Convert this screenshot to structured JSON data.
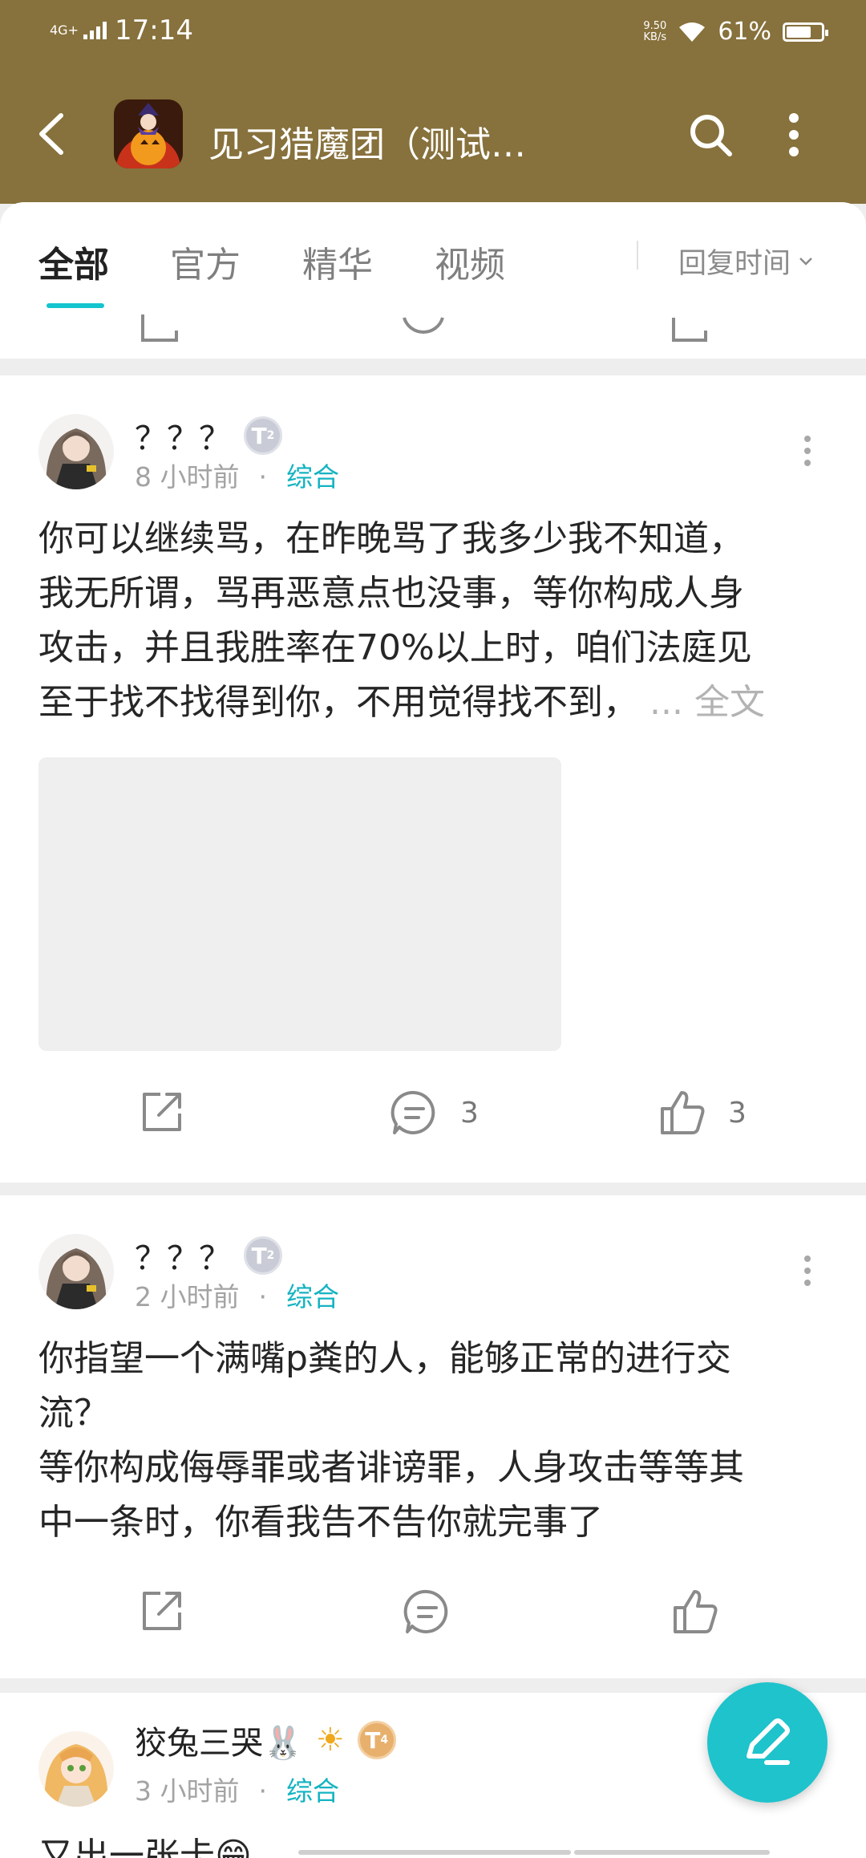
{
  "status_bar": {
    "network": "4G+",
    "time": "17:14",
    "speed_value": "9.50",
    "speed_unit": "KB/s",
    "battery": "61%",
    "battery_level": 0.61
  },
  "app_bar": {
    "title": "见习猎魔团（测试…",
    "game_icon": "game-icon"
  },
  "tabs": [
    {
      "label": "全部",
      "active": true
    },
    {
      "label": "官方",
      "active": false
    },
    {
      "label": "精华",
      "active": false
    },
    {
      "label": "视频",
      "active": false
    }
  ],
  "sort": {
    "label": "回复时间"
  },
  "posts": [
    {
      "username": "？？？",
      "badge": "T",
      "badge_sub": "2",
      "time": "8 小时前",
      "separator": "·",
      "category": "综合",
      "lines": [
        "你可以继续骂，在昨晚骂了我多少我不知道，",
        "我无所谓，骂再恶意点也没事，等你构成人身",
        "攻击，并且我胜率在70%以上时，咱们法庭见",
        "至于找不找得到你，不用觉得找不到，"
      ],
      "more_label": "... 全文",
      "comments": "3",
      "likes": "3"
    },
    {
      "username": "？？？",
      "badge": "T",
      "badge_sub": "2",
      "time": "2 小时前",
      "separator": "·",
      "category": "综合",
      "lines": [
        "你指望一个满嘴p粪的人，能够正常的进行交",
        "流？",
        "等你构成侮辱罪或者诽谤罪，人身攻击等等其",
        "中一条时，你看我告不告你就完事了"
      ]
    },
    {
      "username": "狡兔三哭🐰",
      "sticker": "☀",
      "badge": "T",
      "badge_sub": "4",
      "time": "3 小时前",
      "separator": "·",
      "category": "综合",
      "lines": [
        "又出一张卡😁"
      ]
    }
  ],
  "fab": {
    "icon": "pen-icon"
  },
  "colors": {
    "header": "#87713c",
    "accent": "#14c4cf",
    "category": "#14b3c1",
    "fab": "#1ec3cc"
  }
}
